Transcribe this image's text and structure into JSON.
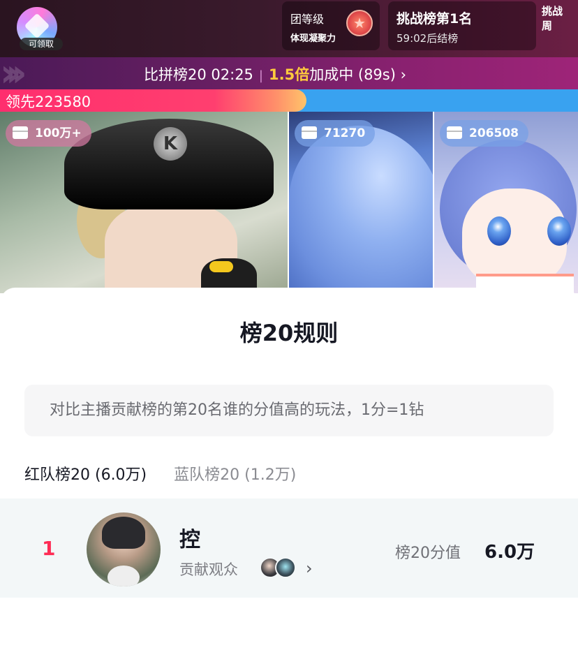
{
  "header": {
    "gem_badge": "可领取",
    "group_level": {
      "title": "团等级",
      "subtitle": "体现凝聚力"
    },
    "challenge": {
      "title": "挑战榜第1名",
      "countdown": "59:02后结榜"
    },
    "week_label": "挑战周"
  },
  "pk_bar": {
    "text": "比拼榜20 02:25",
    "multiplier": "1.5倍",
    "bonus_text": "加成中 (89s)",
    "chevron": "›"
  },
  "score": {
    "lead_text": "领先223580",
    "red_share": 0.53,
    "colors": {
      "red": "#fe2c55",
      "blue": "#39a2f0"
    }
  },
  "streamers": [
    {
      "gift": "100万+"
    },
    {
      "gift": "71270"
    },
    {
      "gift": "206508"
    }
  ],
  "sheet": {
    "title": "榜20规则",
    "description": "对比主播贡献榜的第20名谁的分值高的玩法，1分=1钻",
    "tabs": [
      {
        "label": "红队榜20 (6.0万)",
        "active": true
      },
      {
        "label": "蓝队榜20 (1.2万)",
        "active": false
      }
    ],
    "rows": [
      {
        "rank": "1",
        "name": "控",
        "contrib_label": "贡献观众",
        "score_label": "榜20分值",
        "score_value": "6.0万"
      }
    ]
  },
  "icons": {
    "gift": "gift-icon",
    "chevron": "chevron-right-icon",
    "medal": "star-medal-icon"
  }
}
